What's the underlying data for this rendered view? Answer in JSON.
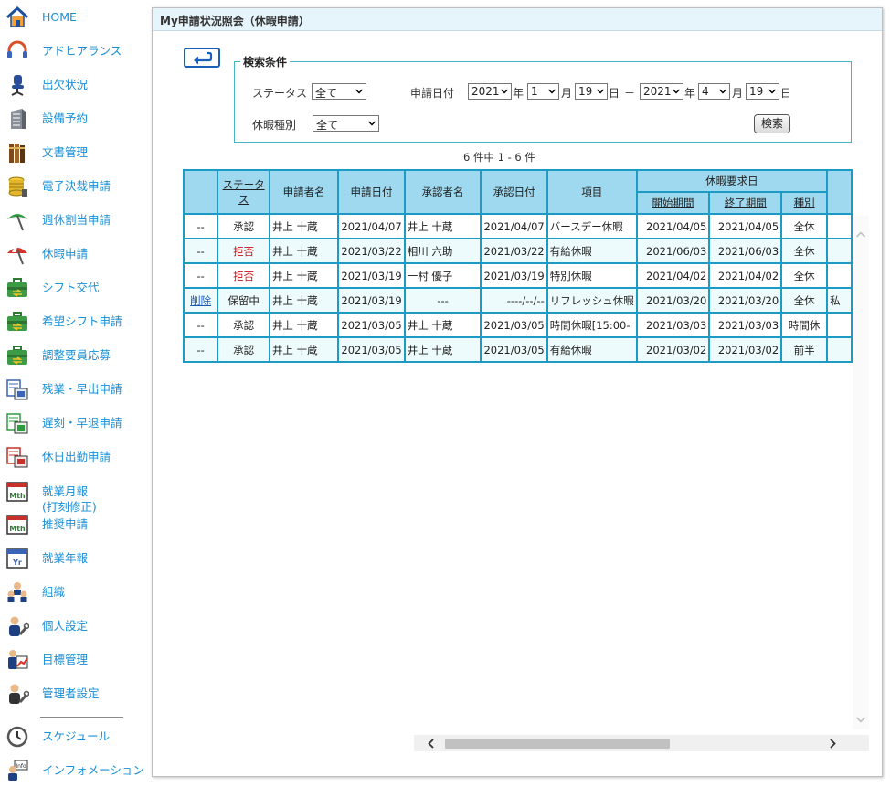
{
  "sidebar": {
    "items": [
      {
        "label": "HOME",
        "icon": "home-icon"
      },
      {
        "label": "アドヒアランス",
        "icon": "headset-icon"
      },
      {
        "label": "出欠状況",
        "icon": "chair-icon"
      },
      {
        "label": "設備予約",
        "icon": "building-icon"
      },
      {
        "label": "文書管理",
        "icon": "books-icon"
      },
      {
        "label": "電子決裁申請",
        "icon": "coins-icon"
      },
      {
        "label": "週休割当申請",
        "icon": "umbrella-icon"
      },
      {
        "label": "休暇申請",
        "icon": "beach-umbrella-icon"
      },
      {
        "label": "シフト交代",
        "icon": "briefcase-icon"
      },
      {
        "label": "希望シフト申請",
        "icon": "briefcase-icon"
      },
      {
        "label": "調整要員応募",
        "icon": "briefcase-icon"
      },
      {
        "label": "残業・早出申請",
        "icon": "overtime-form-icon"
      },
      {
        "label": "遅刻・早退申請",
        "icon": "late-form-icon"
      },
      {
        "label": "休日出勤申請",
        "icon": "holiday-form-icon"
      },
      {
        "label": "就業月報\n(打刻修正)",
        "icon": "month-calendar-icon"
      },
      {
        "label": "推奨申請",
        "icon": "month-calendar-icon"
      },
      {
        "label": "就業年報",
        "icon": "year-calendar-icon"
      },
      {
        "label": "組織",
        "icon": "organization-icon"
      },
      {
        "label": "個人設定",
        "icon": "user-settings-icon"
      },
      {
        "label": "目標管理",
        "icon": "goal-chart-icon"
      },
      {
        "label": "管理者設定",
        "icon": "admin-settings-icon"
      },
      {
        "label": "スケジュール",
        "icon": "clock-icon"
      },
      {
        "label": "インフォメーション",
        "icon": "info-icon"
      }
    ]
  },
  "panel": {
    "title": "My申請状況照会（休暇申請）"
  },
  "search": {
    "legend": "検索条件",
    "status_label": "ステータス",
    "status_value": "全て",
    "date_label": "申請日付",
    "from_year": "2021",
    "from_month": "1",
    "from_day": "19",
    "to_year": "2021",
    "to_month": "4",
    "to_day": "19",
    "year_unit": "年",
    "month_unit": "月",
    "day_unit": "日",
    "range_sep": "－",
    "leave_type_label": "休暇種別",
    "leave_type_value": "全て",
    "search_button": "検索"
  },
  "result_count": "6 件中 1 - 6 件",
  "table": {
    "headers": {
      "status": "ステータス",
      "applicant": "申請者名",
      "apply_date": "申請日付",
      "approver": "承認者名",
      "approve_date": "承認日付",
      "item": "項目",
      "leave_request_date": "休暇要求日",
      "start_period": "開始期間",
      "end_period": "終了期間",
      "type": "種別"
    },
    "rows": [
      {
        "action": "--",
        "status": "承認",
        "status_kind": "approved",
        "applicant": "井上 十蔵",
        "apply_date": "2021/04/07",
        "approver": "井上 十蔵",
        "approve_date": "2021/04/07",
        "item": "バースデー休暇",
        "start": "2021/04/05",
        "end": "2021/04/05",
        "type": "全休",
        "extra": ""
      },
      {
        "action": "--",
        "status": "拒否",
        "status_kind": "rejected",
        "applicant": "井上 十蔵",
        "apply_date": "2021/03/22",
        "approver": "相川 六助",
        "approve_date": "2021/03/22",
        "item": "有給休暇",
        "start": "2021/06/03",
        "end": "2021/06/03",
        "type": "全休",
        "extra": ""
      },
      {
        "action": "--",
        "status": "拒否",
        "status_kind": "rejected",
        "applicant": "井上 十蔵",
        "apply_date": "2021/03/19",
        "approver": "一村 優子",
        "approve_date": "2021/03/19",
        "item": "特別休暇",
        "start": "2021/04/02",
        "end": "2021/04/02",
        "type": "全休",
        "extra": ""
      },
      {
        "action": "削除",
        "status": "保留中",
        "status_kind": "pending",
        "applicant": "井上 十蔵",
        "apply_date": "2021/03/19",
        "approver": "---",
        "approve_date": "----/--/--",
        "item": "リフレッシュ休暇",
        "start": "2021/03/20",
        "end": "2021/03/20",
        "type": "全休",
        "extra": "私"
      },
      {
        "action": "--",
        "status": "承認",
        "status_kind": "approved",
        "applicant": "井上 十蔵",
        "apply_date": "2021/03/05",
        "approver": "井上 十蔵",
        "approve_date": "2021/03/05",
        "item": "時間休暇[15:00-",
        "start": "2021/03/03",
        "end": "2021/03/03",
        "type": "時間休",
        "extra": ""
      },
      {
        "action": "--",
        "status": "承認",
        "status_kind": "approved",
        "applicant": "井上 十蔵",
        "apply_date": "2021/03/05",
        "approver": "井上 十蔵",
        "approve_date": "2021/03/05",
        "item": "有給休暇",
        "start": "2021/03/02",
        "end": "2021/03/02",
        "type": "前半",
        "extra": ""
      }
    ]
  },
  "colors": {
    "nav_text": "#1a8fd6",
    "header_bg": "#9fd9ef",
    "grid_border": "#1d9bc4",
    "rejected": "#c0141c",
    "link": "#1b58b8"
  }
}
